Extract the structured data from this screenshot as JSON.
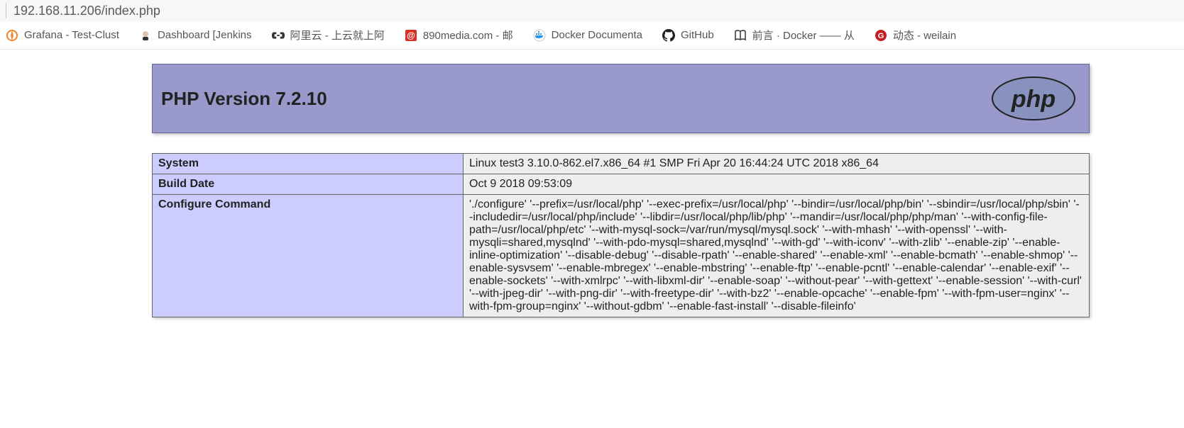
{
  "address_bar": {
    "url": "192.168.11.206/index.php"
  },
  "bookmarks": [
    {
      "icon_color": "#f58220",
      "icon_glyph": "✹",
      "label": "Grafana - Test-Clust"
    },
    {
      "icon_color": "#888",
      "icon_glyph": "👴",
      "label": "Dashboard [Jenkins"
    },
    {
      "icon_color": "#333",
      "icon_glyph": "〔-〕",
      "label": "阿里云 - 上云就上阿"
    },
    {
      "icon_color": "#e23",
      "icon_glyph": "@",
      "label": "890media.com - 邮"
    },
    {
      "icon_color": "#1e88e5",
      "icon_glyph": "🐳",
      "label": "Docker Documenta"
    },
    {
      "icon_color": "#222",
      "icon_glyph": "github",
      "label": "GitHub"
    },
    {
      "icon_color": "#333",
      "icon_glyph": "📖",
      "label": "前言 · Docker —— 从"
    },
    {
      "icon_color": "#e62b1e",
      "icon_glyph": "G",
      "label": "动态 - weilain"
    }
  ],
  "phpinfo": {
    "header_title": "PHP Version 7.2.10",
    "rows": [
      {
        "key": "System",
        "val": "Linux test3 3.10.0-862.el7.x86_64 #1 SMP Fri Apr 20 16:44:24 UTC 2018 x86_64"
      },
      {
        "key": "Build Date",
        "val": "Oct 9 2018 09:53:09"
      },
      {
        "key": "Configure Command",
        "val": "'./configure' '--prefix=/usr/local/php' '--exec-prefix=/usr/local/php' '--bindir=/usr/local/php/bin' '--sbindir=/usr/local/php/sbin' '--includedir=/usr/local/php/include' '--libdir=/usr/local/php/lib/php' '--mandir=/usr/local/php/php/man' '--with-config-file-path=/usr/local/php/etc' '--with-mysql-sock=/var/run/mysql/mysql.sock' '--with-mhash' '--with-openssl' '--with-mysqli=shared,mysqlnd' '--with-pdo-mysql=shared,mysqlnd' '--with-gd' '--with-iconv' '--with-zlib' '--enable-zip' '--enable-inline-optimization' '--disable-debug' '--disable-rpath' '--enable-shared' '--enable-xml' '--enable-bcmath' '--enable-shmop' '--enable-sysvsem' '--enable-mbregex' '--enable-mbstring' '--enable-ftp' '--enable-pcntl' '--enable-calendar' '--enable-exif' '--enable-sockets' '--with-xmlrpc' '--with-libxml-dir' '--enable-soap' '--without-pear' '--with-gettext' '--enable-session' '--with-curl' '--with-jpeg-dir' '--with-png-dir' '--with-freetype-dir' '--with-bz2' '--enable-opcache' '--enable-fpm' '--with-fpm-user=nginx' '--with-fpm-group=nginx' '--without-gdbm' '--enable-fast-install' '--disable-fileinfo'"
      }
    ]
  }
}
